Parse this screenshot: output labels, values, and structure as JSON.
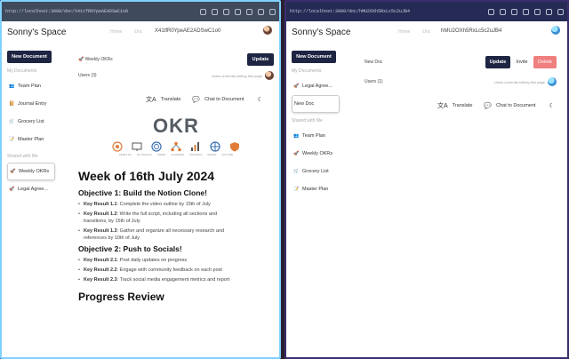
{
  "left": {
    "url": "http://localhost:3000/doc/X41tfR0YpeAEADSwC1o0",
    "space_title": "Sonny's Space",
    "nav": [
      "Home",
      "Doc"
    ],
    "doc_id": "X41tfR0YpeAE2ADSwC1o0",
    "new_document": "New Document",
    "section_my": "My Documents",
    "my_docs": [
      {
        "emoji": "👥",
        "label": "Team Plan"
      },
      {
        "emoji": "📔",
        "label": "Journal Entry"
      },
      {
        "emoji": "🛒",
        "label": "Grocery List"
      },
      {
        "emoji": "📝",
        "label": "Master Plan"
      }
    ],
    "section_shared": "Shared with Me",
    "shared_docs": [
      {
        "emoji": "🚀",
        "label": "Weekly OKRs"
      },
      {
        "emoji": "🚀",
        "label": "Legal Agree..."
      }
    ],
    "doc_title": "Weekly OKRs",
    "doc_emoji": "🚀",
    "update": "Update",
    "users": "Users (3)",
    "users_note": "Users currently editing this page",
    "translate": "Translate",
    "chat": "Chat to Document",
    "okr_title": "OKR",
    "okr_captions": [
      "OBJECTIVE",
      "KEY RESULTS",
      "TARGET",
      "ALIGNMENT",
      "PROGRESS",
      "REVIEW",
      "OUTCOME"
    ],
    "week_heading": "Week of 16th July 2024",
    "objective1": "Objective 1: Build the Notion Clone!",
    "kr1": [
      {
        "k": "Key Result 1.1",
        "t": ": Complete the video outline by 15th of July"
      },
      {
        "k": "Key Result 1.2",
        "t": ": Write the full script, including all sections and transitions, by 15th of July"
      },
      {
        "k": "Key Result 1.3",
        "t": ": Gather and organize all necessary research and references by 10th of July"
      }
    ],
    "objective2": "Objective 2: Push to Socials!",
    "kr2": [
      {
        "k": "Key Result 2.1",
        "t": ": Post daily updates on progress"
      },
      {
        "k": "Key Result 2.2",
        "t": ": Engage with community feedback on each post"
      },
      {
        "k": "Key Result 2.3",
        "t": ": Track social media engagement metrics and report"
      }
    ],
    "progress_heading": "Progress Review"
  },
  "right": {
    "url": "http://localhost:3000/doc/hMU2OXh5RxLc5c2uJB4",
    "space_title": "Sonny's Space",
    "nav": [
      "Home",
      "Doc"
    ],
    "doc_id": "hMU2OXh5RxLc5c2uJB4",
    "new_document": "New Document",
    "section_my": "My Documents",
    "my_docs": [
      {
        "emoji": "🚀",
        "label": "Legal Agree..."
      },
      {
        "emoji": "",
        "label": "New Doc"
      }
    ],
    "section_shared": "Shared with Me",
    "shared_docs": [
      {
        "emoji": "👥",
        "label": "Team Plan"
      },
      {
        "emoji": "🚀",
        "label": "Weekly OKRs"
      },
      {
        "emoji": "🛒",
        "label": "Grocery List"
      },
      {
        "emoji": "📝",
        "label": "Master Plan"
      }
    ],
    "doc_title": "New Doc",
    "update": "Update",
    "invite": "Invite",
    "delete": "Delete",
    "users": "Users (1)",
    "users_note": "Users currently editing this page",
    "translate": "Translate",
    "chat": "Chat to Document"
  },
  "colors": {
    "accent_dark": "#1d2542",
    "delete": "#f07f7f",
    "left_border": "#7fd1ff"
  }
}
